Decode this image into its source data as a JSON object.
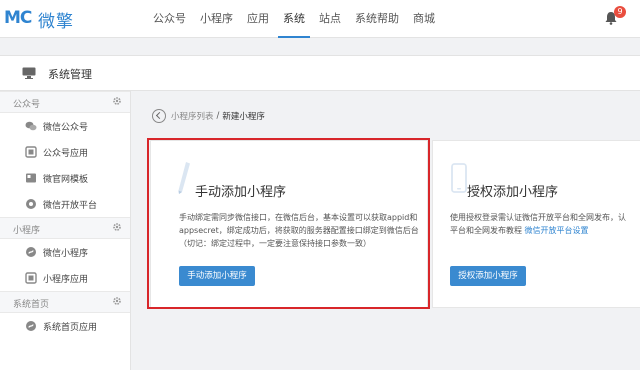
{
  "logo": {
    "mark": "MC",
    "text": "微擎"
  },
  "nav": {
    "items": [
      {
        "label": "公众号"
      },
      {
        "label": "小程序"
      },
      {
        "label": "应用"
      },
      {
        "label": "系统",
        "active": true
      },
      {
        "label": "站点"
      },
      {
        "label": "系统帮助"
      },
      {
        "label": "商城"
      }
    ],
    "notification_count": "9"
  },
  "page_header": {
    "title": "系统管理"
  },
  "sidebar": {
    "sections": [
      {
        "label": "公众号",
        "items": [
          {
            "label": "微信公众号",
            "icon": "wechat-icon"
          },
          {
            "label": "公众号应用",
            "icon": "app-icon"
          },
          {
            "label": "微官网模板",
            "icon": "template-icon"
          },
          {
            "label": "微信开放平台",
            "icon": "open-platform-icon"
          }
        ]
      },
      {
        "label": "小程序",
        "items": [
          {
            "label": "微信小程序",
            "icon": "miniapp-icon"
          },
          {
            "label": "小程序应用",
            "icon": "miniapp-app-icon"
          }
        ]
      },
      {
        "label": "系统首页",
        "items": [
          {
            "label": "系统首页应用",
            "icon": "home-app-icon"
          }
        ]
      }
    ]
  },
  "breadcrumb": {
    "list": "小程序列表",
    "separator": "/",
    "current": "新建小程序"
  },
  "cards": {
    "manual": {
      "title": "手动添加小程序",
      "desc": "手动绑定需同步微信接口，在微信后台，基本设置可以获取appid和appsecret，绑定成功后，将获取的服务器配置接口绑定到微信后台（切记：绑定过程中，一定要注意保持接口参数一致）",
      "button": "手动添加小程序"
    },
    "auth": {
      "title": "授权添加小程序",
      "desc_line1": "使用授权登录需认证微信开放平台和全网发布，认",
      "desc_line2": "平台和全网发布教程 ",
      "desc_link": "微信开放平台设置",
      "button": "授权添加小程序"
    }
  },
  "colors": {
    "brand": "#2f84d0",
    "highlight": "#d8262a",
    "badge": "#e94d3e"
  }
}
